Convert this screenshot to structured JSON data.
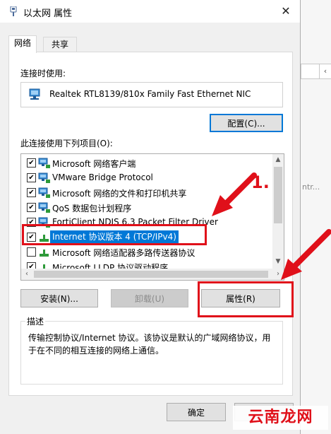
{
  "window": {
    "title": "以太网 属性",
    "close_glyph": "✕"
  },
  "tabs": [
    {
      "label": "网络",
      "active": true
    },
    {
      "label": "共享",
      "active": false
    }
  ],
  "network": {
    "connect_using_label": "连接时使用:",
    "adapter_name": "Realtek RTL8139/810x Family Fast Ethernet NIC",
    "configure_label": "配置(C)...",
    "items_label": "此连接使用下列项目(O):",
    "items": [
      {
        "label": "Microsoft 网络客户端",
        "checked": true,
        "icon": "network-client-icon"
      },
      {
        "label": "VMware Bridge Protocol",
        "checked": true,
        "icon": "network-service-icon"
      },
      {
        "label": "Microsoft 网络的文件和打印机共享",
        "checked": true,
        "icon": "network-service-icon"
      },
      {
        "label": "QoS 数据包计划程序",
        "checked": true,
        "icon": "network-service-icon"
      },
      {
        "label": "FortiClient NDIS 6.3 Packet Filter Driver",
        "checked": true,
        "icon": "network-service-icon"
      },
      {
        "label": "Internet 协议版本 4 (TCP/IPv4)",
        "checked": true,
        "icon": "protocol-icon",
        "selected": true
      },
      {
        "label": "Microsoft 网络适配器多路传送器协议",
        "checked": false,
        "icon": "protocol-icon"
      },
      {
        "label": "Microsoft LLDP 协议驱动程序",
        "checked": true,
        "icon": "protocol-icon"
      }
    ],
    "install_label": "安装(N)...",
    "uninstall_label": "卸载(U)",
    "properties_label": "属性(R)",
    "description_title": "描述",
    "description_text": "传输控制协议/Internet 协议。该协议是默认的广域网络协议，用于在不同的相互连接的网络上通信。"
  },
  "footer": {
    "ok_label": "确定"
  },
  "background": {
    "partial_text": "ntr..."
  },
  "annotations": {
    "step_number": "1.",
    "color": "#e0101a"
  },
  "watermark": "云南龙网",
  "colors": {
    "accent": "#0078d7",
    "annotation": "#e0101a"
  }
}
